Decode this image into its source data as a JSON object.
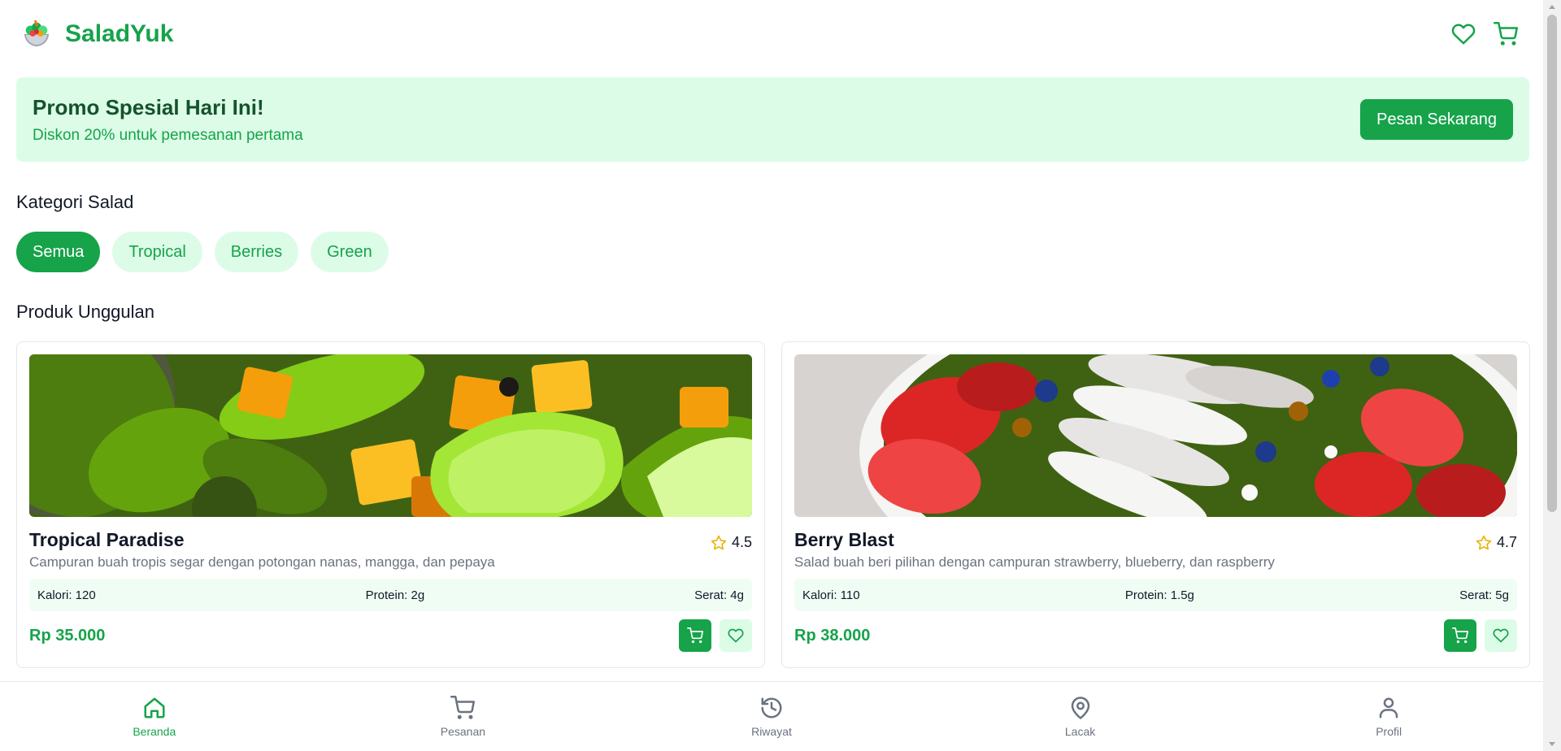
{
  "app": {
    "name": "SaladYuk",
    "colors": {
      "brand": "#16a34a",
      "brand_light": "#dcfce7",
      "brand_dark": "#14532d",
      "star": "#facc15"
    }
  },
  "header": {
    "icons": [
      "salad-bowl-logo",
      "heart-icon",
      "cart-icon"
    ]
  },
  "promo": {
    "title": "Promo Spesial Hari Ini!",
    "subtitle": "Diskon 20% untuk pemesanan pertama",
    "button_label": "Pesan Sekarang"
  },
  "categories": {
    "title": "Kategori Salad",
    "items": [
      {
        "label": "Semua",
        "active": true
      },
      {
        "label": "Tropical",
        "active": false
      },
      {
        "label": "Berries",
        "active": false
      },
      {
        "label": "Green",
        "active": false
      }
    ]
  },
  "featured": {
    "title": "Produk Unggulan",
    "products": [
      {
        "name": "Tropical Paradise",
        "rating": "4.5",
        "description": "Campuran buah tropis segar dengan potongan nanas, mangga, dan pepaya",
        "calories": "Kalori: 120",
        "protein": "Protein: 2g",
        "fiber": "Serat: 4g",
        "price": "Rp 35.000",
        "image": "mango-avocado-salad-photo"
      },
      {
        "name": "Berry Blast",
        "rating": "4.7",
        "description": "Salad buah beri pilihan dengan campuran strawberry, blueberry, dan raspberry",
        "calories": "Kalori: 110",
        "protein": "Protein: 1.5g",
        "fiber": "Serat: 5g",
        "price": "Rp 38.000",
        "image": "berry-chicken-salad-photo"
      }
    ]
  },
  "bottom_nav": {
    "items": [
      {
        "label": "Beranda",
        "icon": "home-icon",
        "active": true
      },
      {
        "label": "Pesanan",
        "icon": "cart-icon",
        "active": false
      },
      {
        "label": "Riwayat",
        "icon": "history-icon",
        "active": false
      },
      {
        "label": "Lacak",
        "icon": "map-pin-icon",
        "active": false
      },
      {
        "label": "Profil",
        "icon": "user-icon",
        "active": false
      }
    ]
  }
}
